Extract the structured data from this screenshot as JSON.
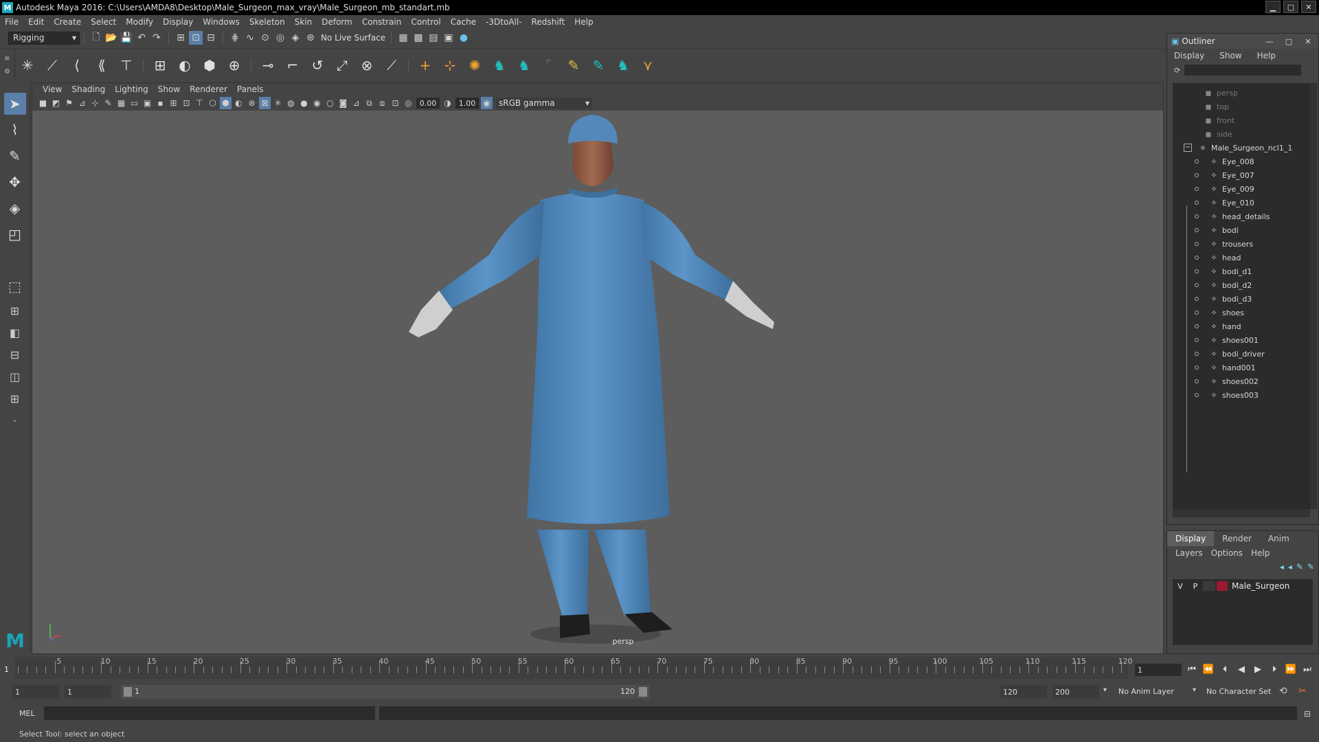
{
  "window": {
    "title": "Autodesk Maya 2016: C:\\Users\\AMDA8\\Desktop\\Male_Surgeon_max_vray\\Male_Surgeon_mb_standart.mb"
  },
  "menubar": [
    "File",
    "Edit",
    "Create",
    "Select",
    "Modify",
    "Display",
    "Windows",
    "Skeleton",
    "Skin",
    "Deform",
    "Constrain",
    "Control",
    "Cache",
    "-3DtoAll-",
    "Redshift",
    "Help"
  ],
  "statusline": {
    "mode": "Rigging",
    "live_surface": "No Live Surface"
  },
  "panel": {
    "menu": [
      "View",
      "Shading",
      "Lighting",
      "Show",
      "Renderer",
      "Panels"
    ],
    "exposure": "0.00",
    "gamma": "1.00",
    "color_management": "sRGB gamma",
    "camera_label": "persp"
  },
  "outliner": {
    "title": "Outliner",
    "menu": [
      "Display",
      "Show",
      "Help"
    ],
    "cameras": [
      "persp",
      "top",
      "front",
      "side"
    ],
    "group": "Male_Surgeon_ncl1_1",
    "children": [
      "Eye_008",
      "Eye_007",
      "Eye_009",
      "Eye_010",
      "head_details",
      "bodi",
      "trousers",
      "head",
      "bodi_d1",
      "bodi_d2",
      "bodi_d3",
      "shoes",
      "hand",
      "shoes001",
      "bodi_driver",
      "hand001",
      "shoes002",
      "shoes003"
    ]
  },
  "layer_editor": {
    "tabs": [
      "Display",
      "Render",
      "Anim"
    ],
    "active_tab": "Display",
    "menu": [
      "Layers",
      "Options",
      "Help"
    ],
    "layer": {
      "v": "V",
      "p": "P",
      "name": "Male_Surgeon",
      "color": "#9b1b30"
    }
  },
  "timeslider": {
    "tick_labels": [
      5,
      10,
      15,
      20,
      25,
      30,
      35,
      40,
      45,
      50,
      55,
      60,
      65,
      70,
      75,
      80,
      85,
      90,
      95,
      100,
      105,
      110,
      115,
      120
    ],
    "current_frame": "1",
    "frame_field": "1"
  },
  "rangeslider": {
    "start": "1",
    "playback_start": "1",
    "bar_start": "1",
    "bar_end": "120",
    "playback_end": "120",
    "end": "200",
    "anim_layer": "No Anim Layer",
    "character_set": "No Character Set"
  },
  "cmdline": {
    "label": "MEL"
  },
  "helpline": {
    "text": "Select Tool: select an object"
  },
  "colors": {
    "gown": "#4f86b8",
    "viewport_bg": "#5d5d5d",
    "highlight": "#5a7fa8"
  }
}
